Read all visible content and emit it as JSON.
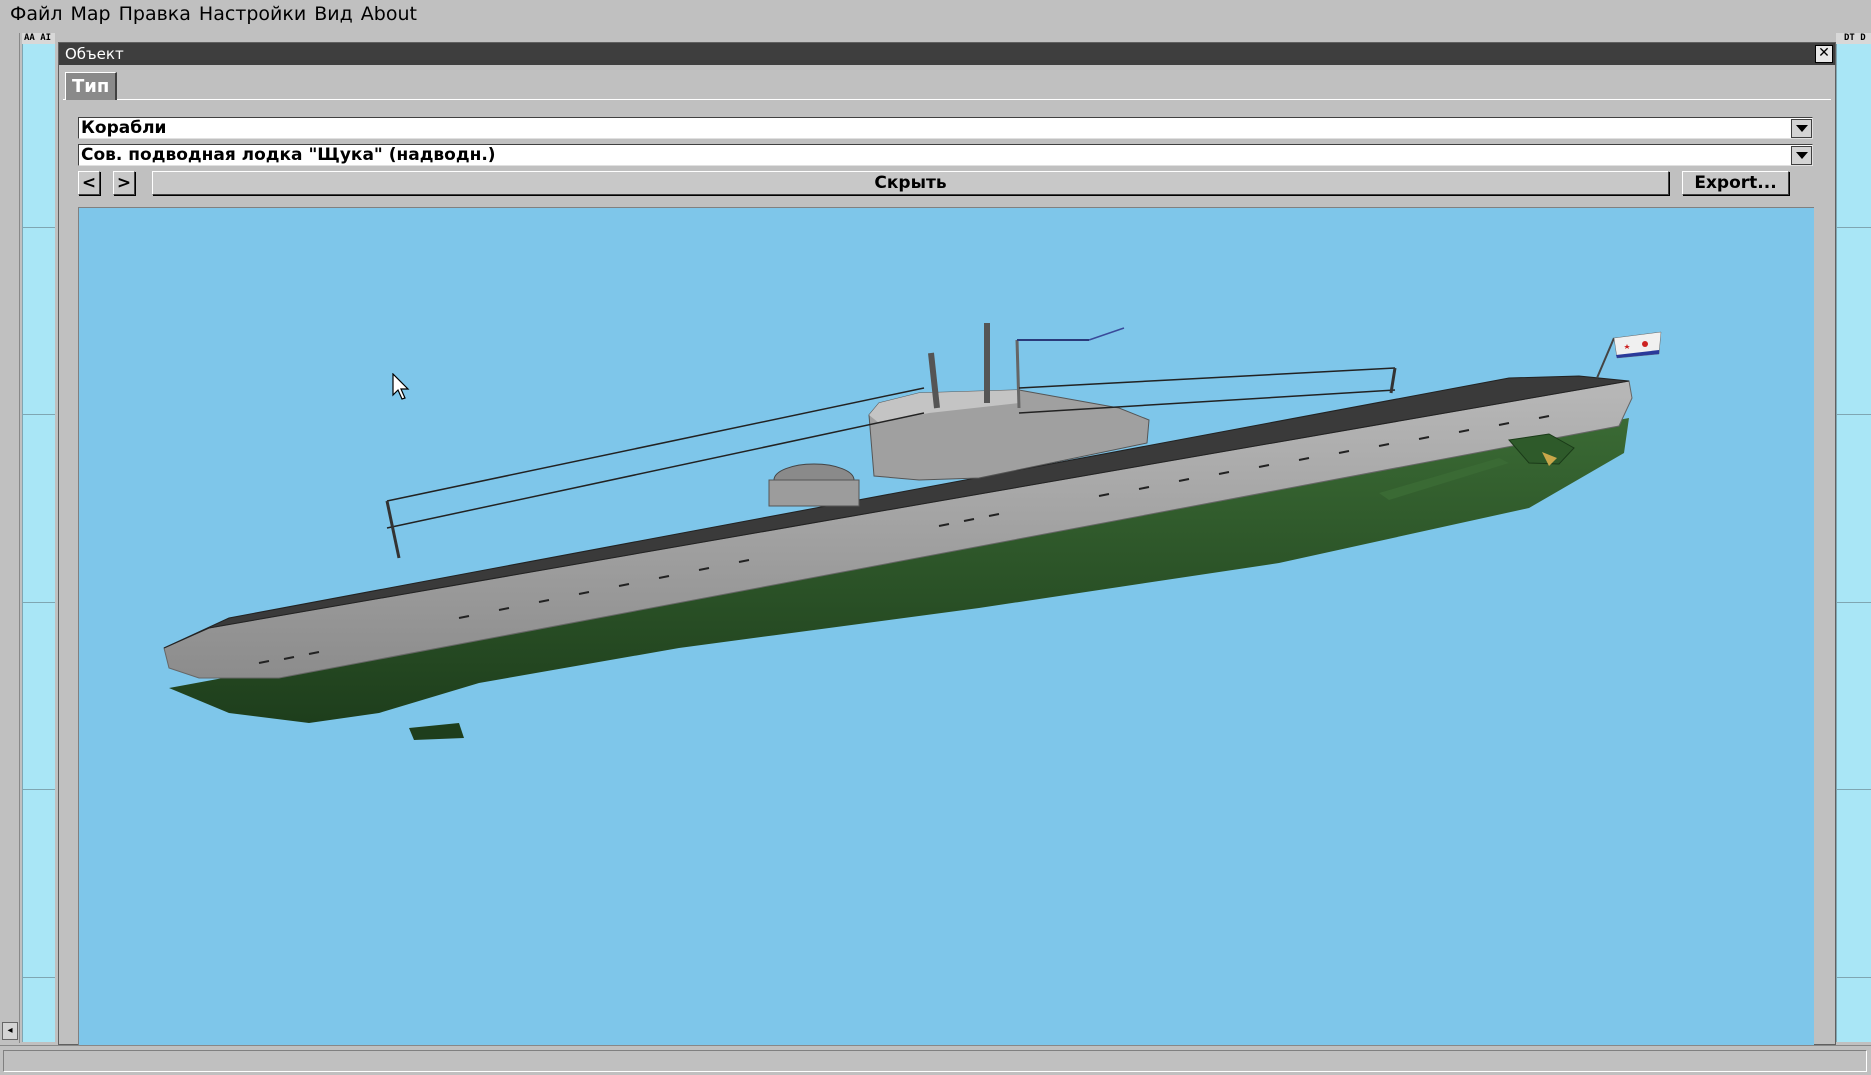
{
  "menubar": {
    "items": [
      "Файл",
      "Мар",
      "Правка",
      "Настройки",
      "Вид",
      "About"
    ]
  },
  "map": {
    "left_ruler_label": "AA AI",
    "right_ruler_label": "DT D"
  },
  "dialog": {
    "title": "Объект",
    "close_symbol": "✕",
    "tabs": [
      {
        "label": "Тип",
        "active": true
      }
    ],
    "category_select": {
      "value": "Корабли"
    },
    "object_select": {
      "value": "Сов. подводная лодка \"Щука\" (надводн.)"
    },
    "prev_label": "<",
    "next_label": ">",
    "hide_label": "Скрыть",
    "export_label": "Export...",
    "viewport_background": "#7ec6ea"
  },
  "colors": {
    "titlebar": "#3e3e3e",
    "hull_upper": "#a8a8a8",
    "hull_lower": "#2e5a2a",
    "deck": "#3a3a3a"
  }
}
